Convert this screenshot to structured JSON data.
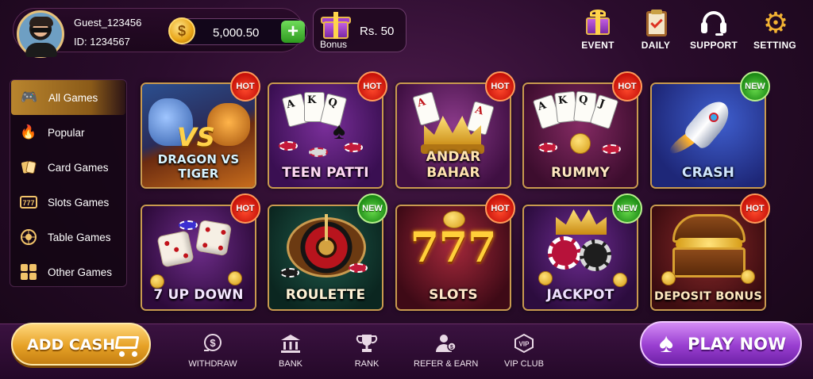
{
  "user": {
    "name": "Guest_123456",
    "id": "ID: 1234567",
    "balance": "5,000.50",
    "coin_symbol": "$"
  },
  "bonus": {
    "label": "Bonus",
    "value": "Rs. 50"
  },
  "top_nav": [
    {
      "label": "EVENT",
      "icon": "gift-icon"
    },
    {
      "label": "DAILY",
      "icon": "clipboard-check-icon"
    },
    {
      "label": "SUPPORT",
      "icon": "headset-icon"
    },
    {
      "label": "SETTING",
      "icon": "gear-icon"
    }
  ],
  "sidebar": {
    "active_index": 0,
    "items": [
      {
        "label": "All Games",
        "icon": "gamepad-icon",
        "glyph": "🎮"
      },
      {
        "label": "Popular",
        "icon": "fire-icon",
        "glyph": "🔥"
      },
      {
        "label": "Card Games",
        "icon": "cards-icon",
        "glyph": "🂡"
      },
      {
        "label": "Slots Games",
        "icon": "slot-777-icon",
        "glyph": "7"
      },
      {
        "label": "Table Games",
        "icon": "roulette-icon",
        "glyph": "◎"
      },
      {
        "label": "Other Games",
        "icon": "grid-icon",
        "glyph": "▦"
      }
    ]
  },
  "games": [
    {
      "name": "DRAGON VS TIGER",
      "badge": "HOT",
      "art": "dragon-tiger"
    },
    {
      "name": "TEEN PATTI",
      "badge": "HOT",
      "art": "teen-patti"
    },
    {
      "name": "ANDAR BAHAR",
      "badge": "HOT",
      "art": "andar-bahar"
    },
    {
      "name": "RUMMY",
      "badge": "HOT",
      "art": "rummy"
    },
    {
      "name": "CRASH",
      "badge": "NEW",
      "art": "crash"
    },
    {
      "name": "7 UP DOWN",
      "badge": "HOT",
      "art": "dice"
    },
    {
      "name": "ROULETTE",
      "badge": "NEW",
      "art": "roulette"
    },
    {
      "name": "SLOTS",
      "badge": "HOT",
      "art": "slots"
    },
    {
      "name": "JACKPOT",
      "badge": "NEW",
      "art": "jackpot"
    },
    {
      "name": "DEPOSIT BONUS",
      "badge": "HOT",
      "art": "treasure"
    }
  ],
  "card_text": {
    "vs": "VS",
    "dt_letters": [
      "A",
      "K",
      "Q"
    ],
    "ab_cards": [
      "A",
      "A"
    ],
    "slots": "777",
    "rummy_cards": [
      "A",
      "K",
      "Q",
      "J"
    ]
  },
  "bottom": {
    "add_cash": "ADD CASH",
    "play_now": "PLAY NOW",
    "nav": [
      {
        "label": "WITHDRAW",
        "icon": "withdraw-icon"
      },
      {
        "label": "BANK",
        "icon": "bank-icon"
      },
      {
        "label": "RANK",
        "icon": "trophy-icon"
      },
      {
        "label": "REFER & EARN",
        "icon": "refer-icon"
      },
      {
        "label": "VIP CLUB",
        "icon": "vip-icon"
      }
    ]
  },
  "colors": {
    "hot_badge": "#d9180f",
    "new_badge": "#2c9a1f",
    "gold_border": "#c99a4f",
    "add_cash": "#e6a126",
    "play_now": "#9a3fd1"
  }
}
